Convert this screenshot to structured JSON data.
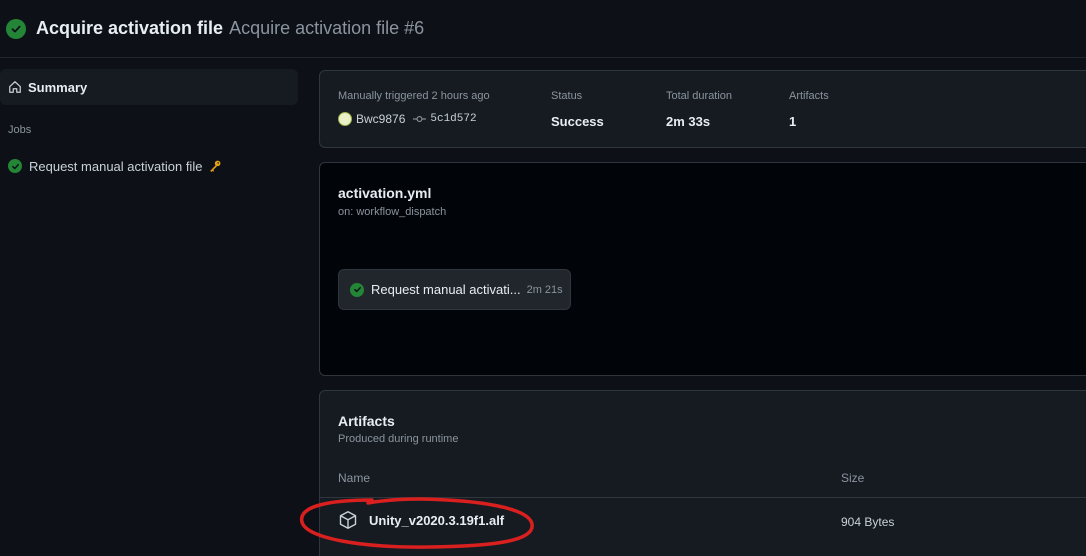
{
  "header": {
    "title": "Acquire activation file",
    "subtitle": "Acquire activation file #6",
    "status_icon": "check-circle-icon"
  },
  "sidebar": {
    "summary_label": "Summary",
    "jobs_heading": "Jobs",
    "jobs": [
      {
        "label": "Request manual activation file",
        "status": "success",
        "icon": "key-icon"
      }
    ]
  },
  "meta": {
    "trigger_label": "Manually triggered 2 hours ago",
    "actor": "Bwc9876",
    "commit": "5c1d572",
    "status_label": "Status",
    "status_value": "Success",
    "duration_label": "Total duration",
    "duration_value": "2m 33s",
    "artifacts_label": "Artifacts",
    "artifacts_value": "1"
  },
  "workflow": {
    "file": "activation.yml",
    "trigger": "on: workflow_dispatch",
    "job_label": "Request manual activati...",
    "job_duration": "2m 21s"
  },
  "artifacts": {
    "title": "Artifacts",
    "subtitle": "Produced during runtime",
    "col_name": "Name",
    "col_size": "Size",
    "rows": [
      {
        "name": "Unity_v2020.3.19f1.alf",
        "size": "904 Bytes"
      }
    ]
  },
  "colors": {
    "success": "#238636",
    "annotation": "#d9201f",
    "background": "#0d1117"
  }
}
